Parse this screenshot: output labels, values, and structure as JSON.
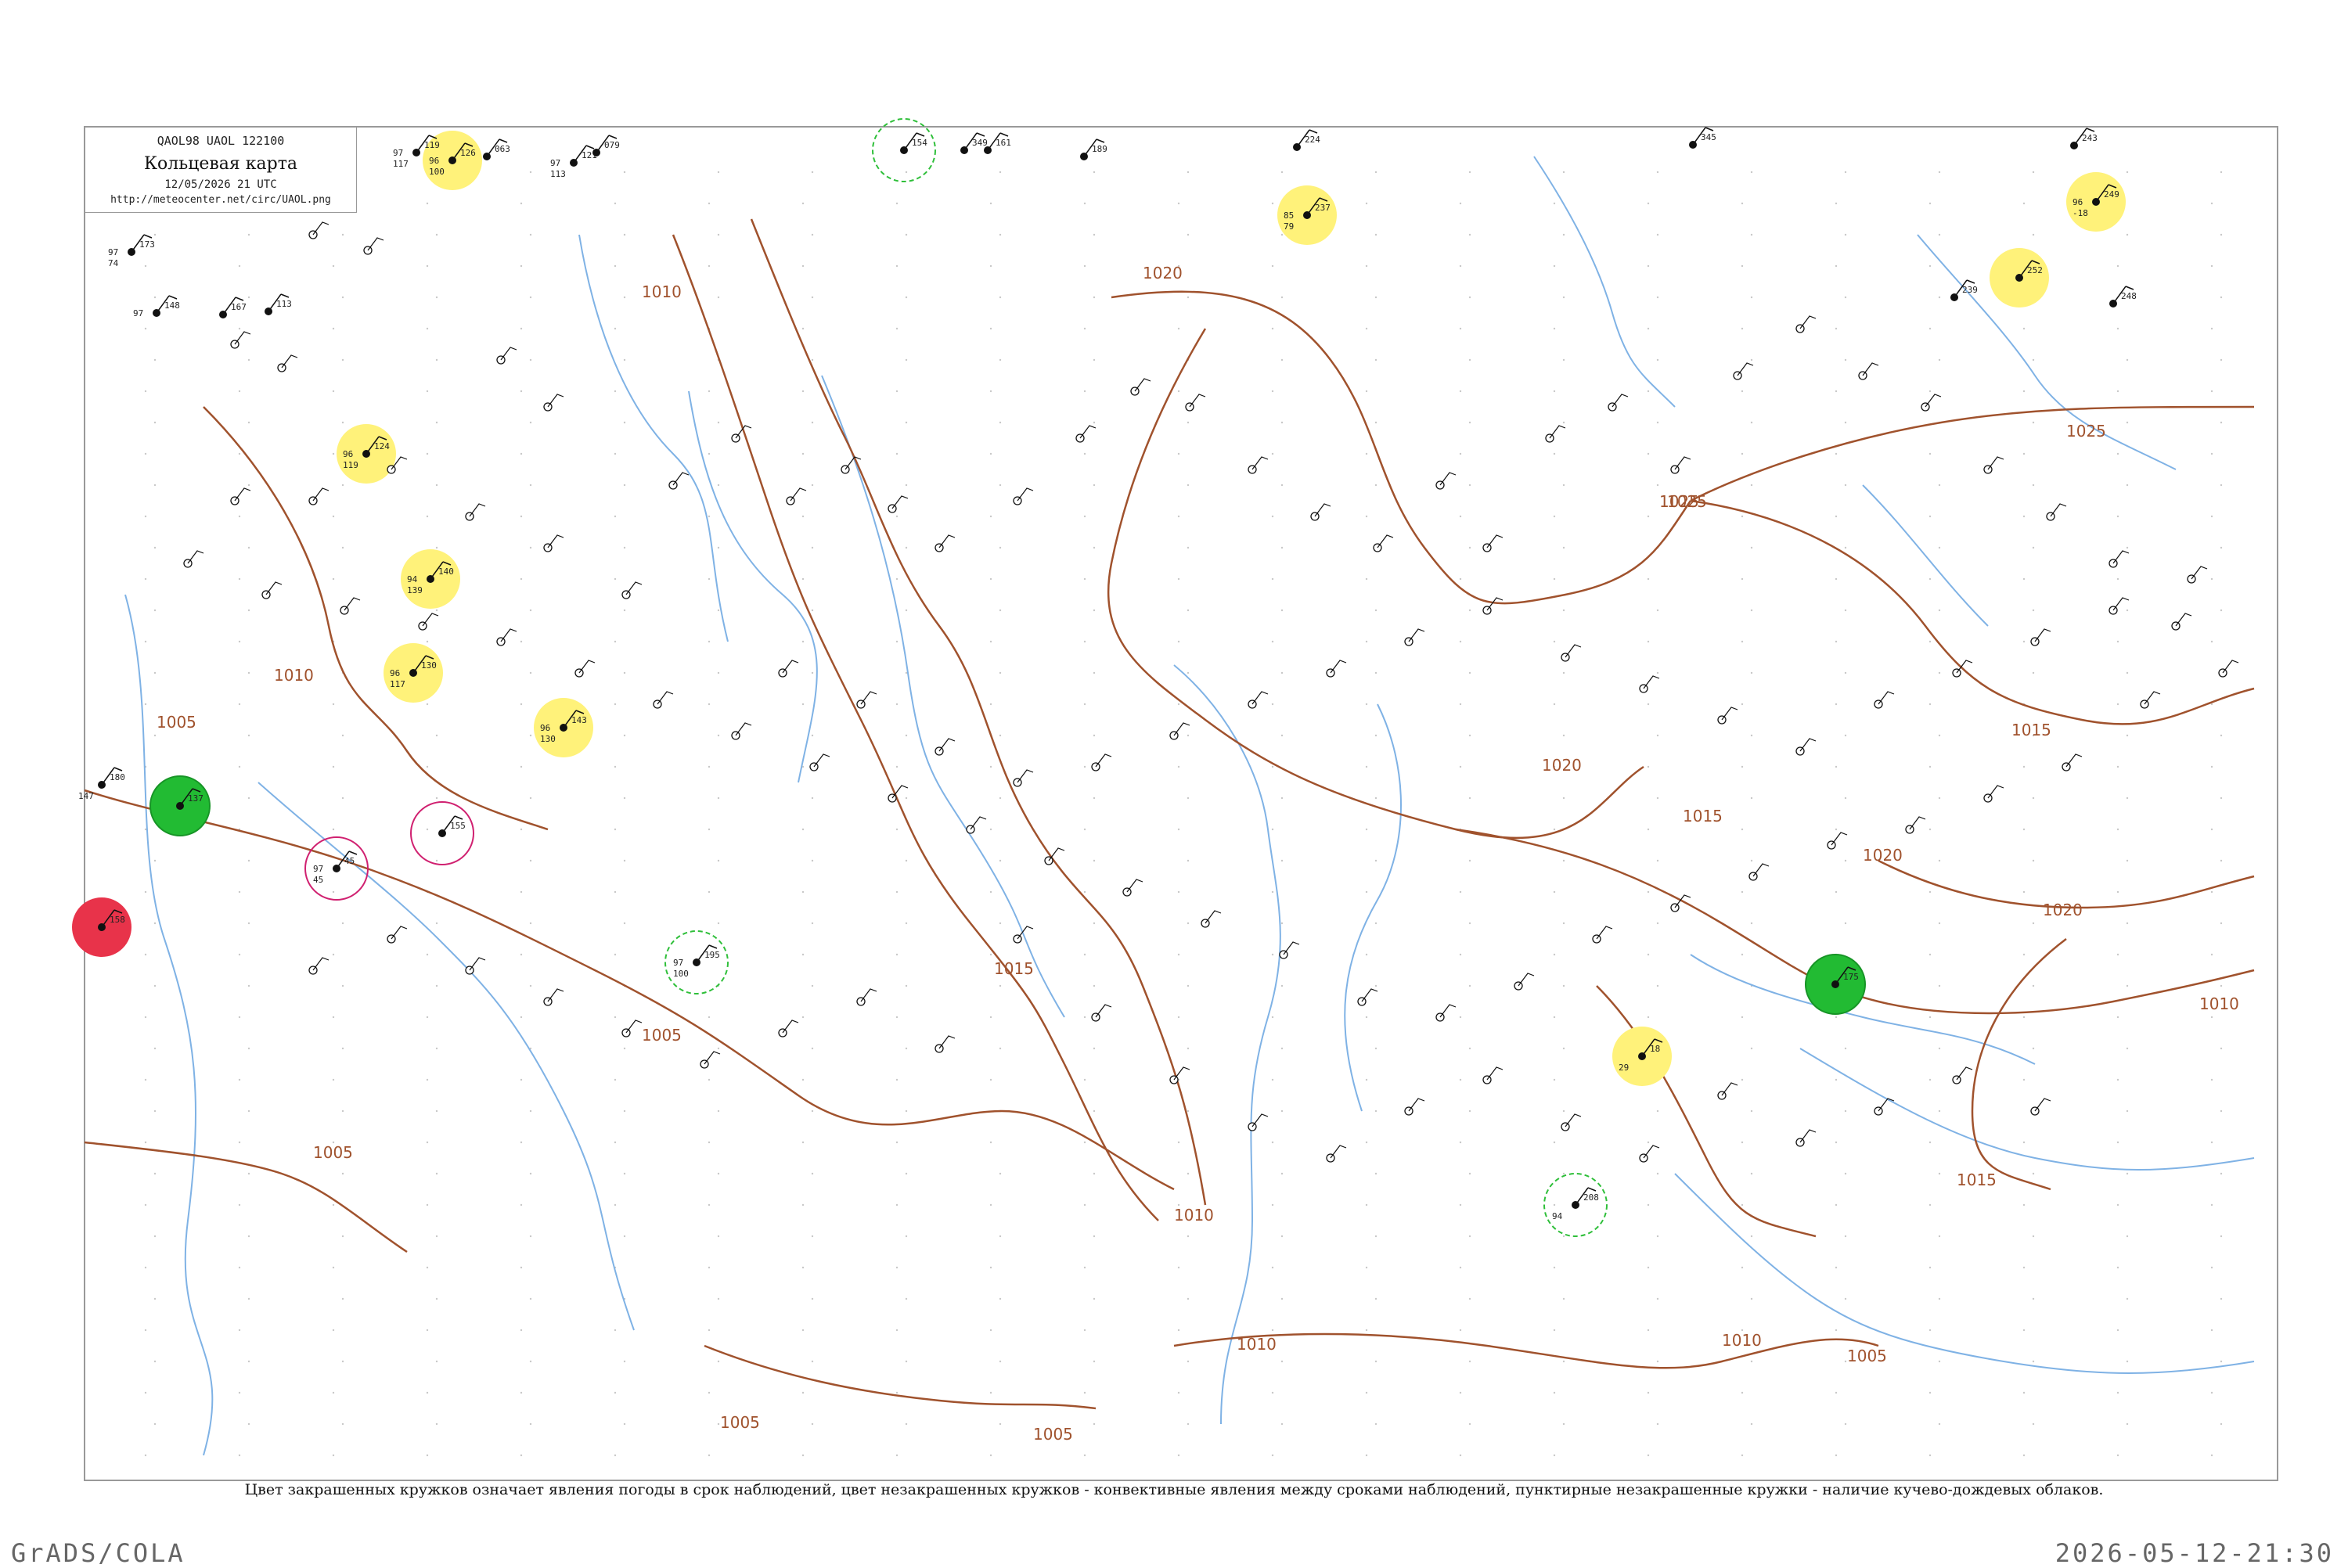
{
  "header": {
    "code": "QAOL98  UAOL  122100",
    "title": "Кольцевая карта",
    "datetime": "12/05/2026 21 UTC",
    "url": "http://meteocenter.net/circ/UAOL.png"
  },
  "footnote": "Цвет закрашенных кружков означает явления погоды в срок наблюдений, цвет незакрашенных кружков - конвективные явления между сроками наблюдений, пунктирные незакрашенные кружки - наличие кучево-дождевых облаков.",
  "credit": "GrADS/COLA",
  "timestamp": "2026-05-12-21:30",
  "colors": {
    "isobar": "#a0522d",
    "river": "#7fb2e5",
    "frame": "#999999",
    "green_fill": "#22bb33",
    "yellow_fill": "#fff27a",
    "red_fill": "#e8334a",
    "green_dash": "#2fbf3a",
    "magenta_ring": "#d02070"
  },
  "isobar_labels": [
    "1005",
    "1010",
    "1005",
    "1010",
    "1015",
    "1020",
    "1020",
    "1025",
    "1025",
    "1015",
    "1020",
    "1015",
    "1020",
    "1010",
    "1015",
    "1005",
    "1010",
    "1010",
    "1005",
    "1005",
    "1010",
    "1005",
    "1025"
  ],
  "stations": [
    {
      "pressure": "126",
      "temp": "96",
      "dew": "100",
      "fill": "yellow"
    },
    {
      "pressure": "063",
      "temp": "",
      "dew": "",
      "fill": "none"
    },
    {
      "pressure": "119",
      "temp": "97",
      "dew": "117",
      "fill": "none"
    },
    {
      "pressure": "121",
      "temp": "97",
      "dew": "113",
      "fill": "none"
    },
    {
      "pressure": "079",
      "temp": "",
      "dew": "",
      "fill": "none"
    },
    {
      "pressure": "154",
      "temp": "",
      "dew": "",
      "fill": "green-dashed"
    },
    {
      "pressure": "349",
      "temp": "",
      "dew": "",
      "fill": "none"
    },
    {
      "pressure": "161",
      "temp": "",
      "dew": "",
      "fill": "none"
    },
    {
      "pressure": "189",
      "temp": "",
      "dew": "",
      "fill": "none"
    },
    {
      "pressure": "224",
      "temp": "",
      "dew": "",
      "fill": "none"
    },
    {
      "pressure": "237",
      "temp": "85",
      "dew": "79",
      "fill": "yellow"
    },
    {
      "pressure": "345",
      "temp": "",
      "dew": "",
      "fill": "none"
    },
    {
      "pressure": "243",
      "temp": "",
      "dew": "",
      "fill": "none"
    },
    {
      "pressure": "249",
      "temp": "96",
      "dew": "-18",
      "fill": "yellow"
    },
    {
      "pressure": "173",
      "temp": "97",
      "dew": "74",
      "fill": "none"
    },
    {
      "pressure": "148",
      "temp": "97",
      "dew": "",
      "fill": "none"
    },
    {
      "pressure": "167",
      "temp": "",
      "dew": "",
      "fill": "none"
    },
    {
      "pressure": "113",
      "temp": "",
      "dew": "",
      "fill": "none"
    },
    {
      "pressure": "252",
      "temp": "",
      "dew": "",
      "fill": "yellow"
    },
    {
      "pressure": "239",
      "temp": "",
      "dew": "",
      "fill": "none"
    },
    {
      "pressure": "248",
      "temp": "",
      "dew": "",
      "fill": "none"
    },
    {
      "pressure": "180",
      "temp": "",
      "dew": "147",
      "fill": "none"
    },
    {
      "pressure": "137",
      "temp": "",
      "dew": "",
      "fill": "green"
    },
    {
      "pressure": "158",
      "temp": "",
      "dew": "",
      "fill": "red"
    },
    {
      "pressure": "124",
      "temp": "96",
      "dew": "119",
      "fill": "yellow"
    },
    {
      "pressure": "140",
      "temp": "94",
      "dew": "139",
      "fill": "yellow"
    },
    {
      "pressure": "130",
      "temp": "96",
      "dew": "117",
      "fill": "yellow"
    },
    {
      "pressure": "143",
      "temp": "96",
      "dew": "130",
      "fill": "yellow"
    },
    {
      "pressure": "195",
      "temp": "97",
      "dew": "100",
      "fill": "green-dashed"
    },
    {
      "pressure": "18",
      "temp": "",
      "dew": "29",
      "fill": "yellow"
    },
    {
      "pressure": "208",
      "temp": "",
      "dew": "94",
      "fill": "green-dashed"
    },
    {
      "pressure": "175",
      "temp": "",
      "dew": "",
      "fill": "green"
    },
    {
      "pressure": "45",
      "temp": "97",
      "dew": "45",
      "fill": "magenta-ring"
    },
    {
      "pressure": "155",
      "temp": "",
      "dew": "",
      "fill": "magenta-ring"
    }
  ]
}
